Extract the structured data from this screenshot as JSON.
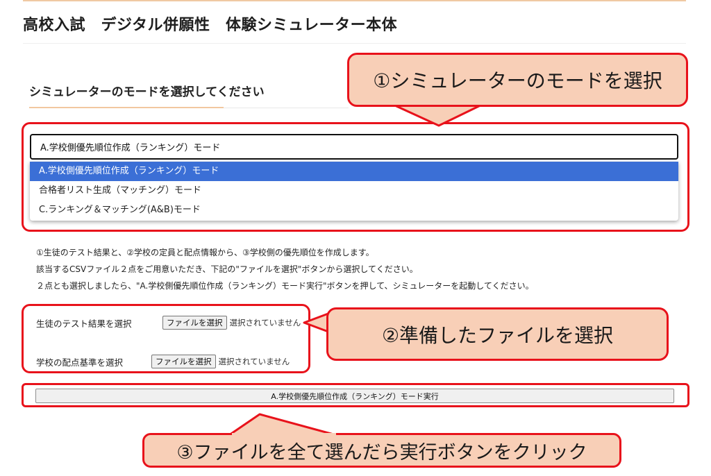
{
  "page": {
    "title": "高校入試　デジタル併願性　体験シミュレーター本体"
  },
  "mode_section": {
    "heading": "シミュレーターのモードを選択してください",
    "selected_value": "A.学校側優先順位作成（ランキング）モード",
    "options": [
      "A.学校側優先順位作成（ランキング）モード",
      "合格者リスト生成（マッチング）モード",
      "C.ランキング＆マッチング(A&B)モード"
    ]
  },
  "description": {
    "lines": [
      "①生徒のテスト結果と、②学校の定員と配点情報から、③学校側の優先順位を作成します。",
      "該当するCSVファイル２点をご用意いただき、下記の\"ファイルを選択\"ボタンから選択してください。",
      "２点とも選択しましたら、\"A.学校側優先順位作成（ランキング）モード実行\"ボタンを押して、シミュレーターを起動してください。"
    ]
  },
  "file_inputs": [
    {
      "label": "生徒のテスト結果を選択",
      "button": "ファイルを選択",
      "status": "選択されていません"
    },
    {
      "label": "学校の配点基準を選択",
      "button": "ファイルを選択",
      "status": "選択されていません"
    }
  ],
  "run_button": {
    "label": "A.学校側優先順位作成（ランキング）モード実行"
  },
  "callouts": {
    "step1": "①シミュレーターのモードを選択",
    "step2": "②準備したファイルを選択",
    "step3": "③ファイルを全て選んだら実行ボタンをクリック"
  },
  "colors": {
    "annotation_red": "#e8121b",
    "callout_fill": "#f8cfb7",
    "selected_option": "#3b6fd6",
    "accent_underline": "#f2c7a0"
  }
}
